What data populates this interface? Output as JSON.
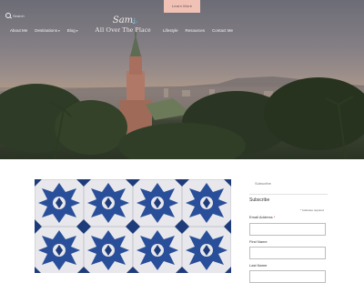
{
  "header": {
    "cta_label": "Learn More",
    "search_placeholder": "Search",
    "nav_left": [
      {
        "label": "About Me"
      },
      {
        "label": "Destinations"
      },
      {
        "label": "Blog"
      }
    ],
    "nav_right": [
      {
        "label": "Lifestyle"
      },
      {
        "label": "Resources"
      },
      {
        "label": "Contact Me"
      }
    ],
    "logo": {
      "script": "Sam",
      "sub": "All Over The Place"
    }
  },
  "sidebar": {
    "widget_title": "Subscribe",
    "form_title": "Subscribe",
    "required_note": "indicates required",
    "fields": [
      {
        "label": "Email Address",
        "required": true
      },
      {
        "label": "First Name"
      },
      {
        "label": "Last Name"
      }
    ]
  },
  "colors": {
    "cta_bg": "#efc2b5",
    "tile_blue": "#2a4f9a",
    "text": "#333333"
  }
}
